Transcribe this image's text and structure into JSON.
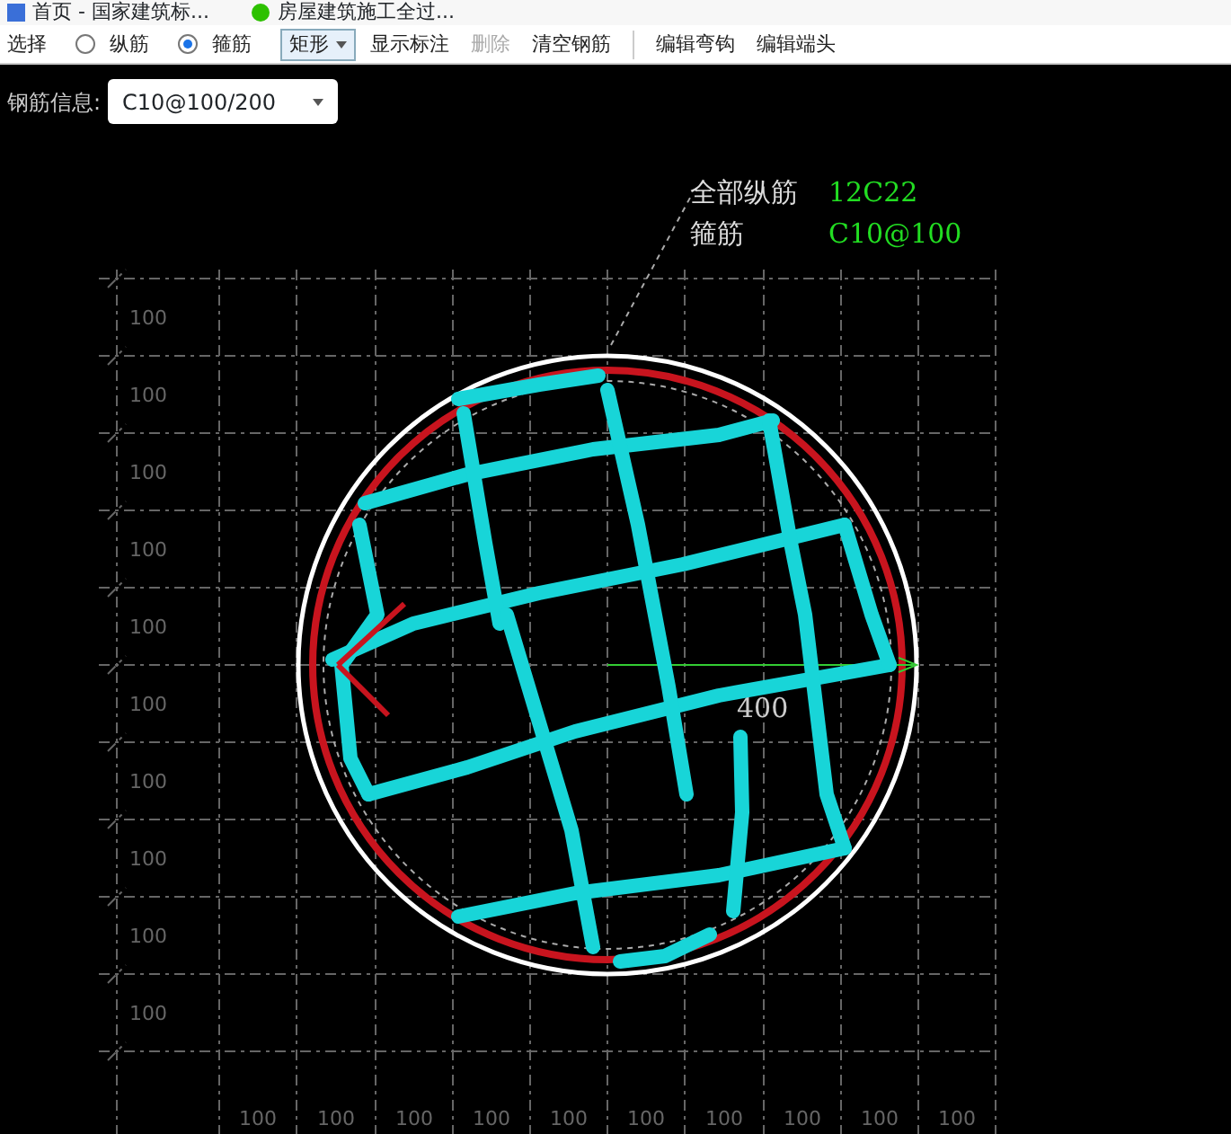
{
  "bookmarks": [
    {
      "label": "首页 - 国家建筑标...",
      "kind": "page"
    },
    {
      "label": "房屋建筑施工全过...",
      "kind": "chat"
    }
  ],
  "toolbar": [
    {
      "kind": "text",
      "label": "选择"
    },
    {
      "kind": "radio",
      "label": "纵筋",
      "selected": false
    },
    {
      "kind": "radio",
      "label": "箍筋",
      "selected": true
    },
    {
      "kind": "dropdown",
      "label": "矩形"
    },
    {
      "kind": "button",
      "label": "显示标注",
      "disabled": false
    },
    {
      "kind": "button",
      "label": "删除",
      "disabled": true
    },
    {
      "kind": "button",
      "label": "清空钢筋",
      "disabled": false
    },
    {
      "kind": "separator"
    },
    {
      "kind": "button",
      "label": "编辑弯钩",
      "disabled": false
    },
    {
      "kind": "button",
      "label": "编辑端头",
      "disabled": false
    }
  ],
  "rebar_info": {
    "label": "钢筋信息:",
    "value": "C10@100/200"
  },
  "annotation": [
    {
      "label": "全部纵筋",
      "value": "12C22"
    },
    {
      "label": "箍筋",
      "value": "C10@100"
    }
  ],
  "dimension": "400",
  "row_labels": [
    "100",
    "100",
    "100",
    "100",
    "100",
    "100",
    "100",
    "100",
    "100",
    "100"
  ],
  "column_labels": [
    "100",
    "100",
    "100",
    "100",
    "100",
    "100",
    "100",
    "100",
    "100",
    "100"
  ]
}
